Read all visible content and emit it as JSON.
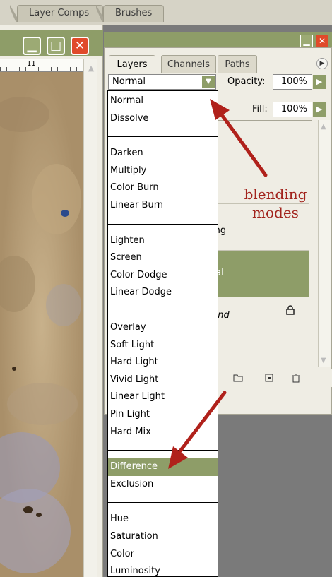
{
  "top_tabs": [
    {
      "label": "Layer Comps"
    },
    {
      "label": "Brushes"
    }
  ],
  "document": {
    "ruler_number": "11"
  },
  "panel": {
    "tabs": [
      {
        "label": "Layers"
      },
      {
        "label": "Channels"
      },
      {
        "label": "Paths"
      }
    ],
    "blend_mode_value": "Normal",
    "opacity_label": "Opacity:",
    "opacity_value": "100%",
    "fill_label": "Fill:",
    "fill_value": "100%",
    "layer_fragments": [
      "ing",
      "tal",
      "und"
    ]
  },
  "annotation": {
    "line1": "blending",
    "line2": "modes"
  },
  "dropdown": {
    "selected": "Difference",
    "groups": [
      [
        "Normal",
        "Dissolve"
      ],
      [
        "Darken",
        "Multiply",
        "Color Burn",
        "Linear Burn"
      ],
      [
        "Lighten",
        "Screen",
        "Color Dodge",
        "Linear Dodge"
      ],
      [
        "Overlay",
        "Soft Light",
        "Hard Light",
        "Vivid Light",
        "Linear Light",
        "Pin Light",
        "Hard Mix"
      ],
      [
        "Difference",
        "Exclusion"
      ],
      [
        "Hue",
        "Saturation",
        "Color",
        "Luminosity"
      ]
    ]
  },
  "colors": {
    "accent_green": "#8e9d68",
    "annotation_red": "#a2241d",
    "close_red": "#e04a2a"
  }
}
